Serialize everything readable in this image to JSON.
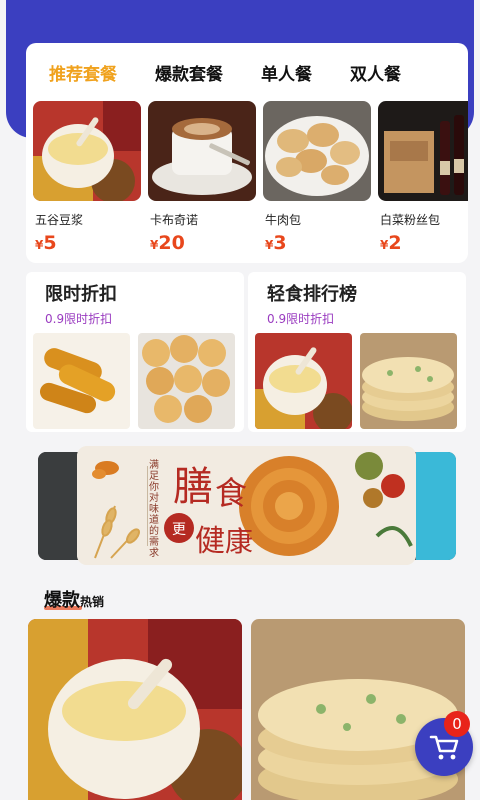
{
  "tabs": [
    {
      "label": "推荐套餐",
      "active": true
    },
    {
      "label": "爆款套餐",
      "active": false
    },
    {
      "label": "单人餐",
      "active": false
    },
    {
      "label": "双人餐",
      "active": false
    }
  ],
  "products": [
    {
      "name": "五谷豆浆",
      "currency": "¥",
      "price": "5",
      "image": "soy-milk"
    },
    {
      "name": "卡布奇诺",
      "currency": "¥",
      "price": "20",
      "image": "cappuccino"
    },
    {
      "name": "牛肉包",
      "currency": "¥",
      "price": "3",
      "image": "beef-buns"
    },
    {
      "name": "白菜粉丝包",
      "currency": "¥",
      "price": "2",
      "image": "wine-box"
    }
  ],
  "promos": [
    {
      "title": "限时折扣",
      "subtitle": "0.9限时折扣",
      "images": [
        "fried-dough",
        "sesame-balls"
      ]
    },
    {
      "title": "轻食排行榜",
      "subtitle": "0.9限时折扣",
      "images": [
        "soy-milk",
        "pancake"
      ]
    }
  ],
  "banner": {
    "tagline": "满足你对味道的需求",
    "char1": "膳",
    "char2": "食",
    "char3": "更",
    "char4": "健",
    "char5": "康"
  },
  "section": {
    "main": "爆款",
    "sub": "热销"
  },
  "hot_items": [
    "soy-milk",
    "pancake"
  ],
  "cart": {
    "count": "0"
  },
  "colors": {
    "brand": "#3b3fc0",
    "accent": "#f0a21e",
    "price": "#e8471c",
    "badge": "#e8241a"
  }
}
